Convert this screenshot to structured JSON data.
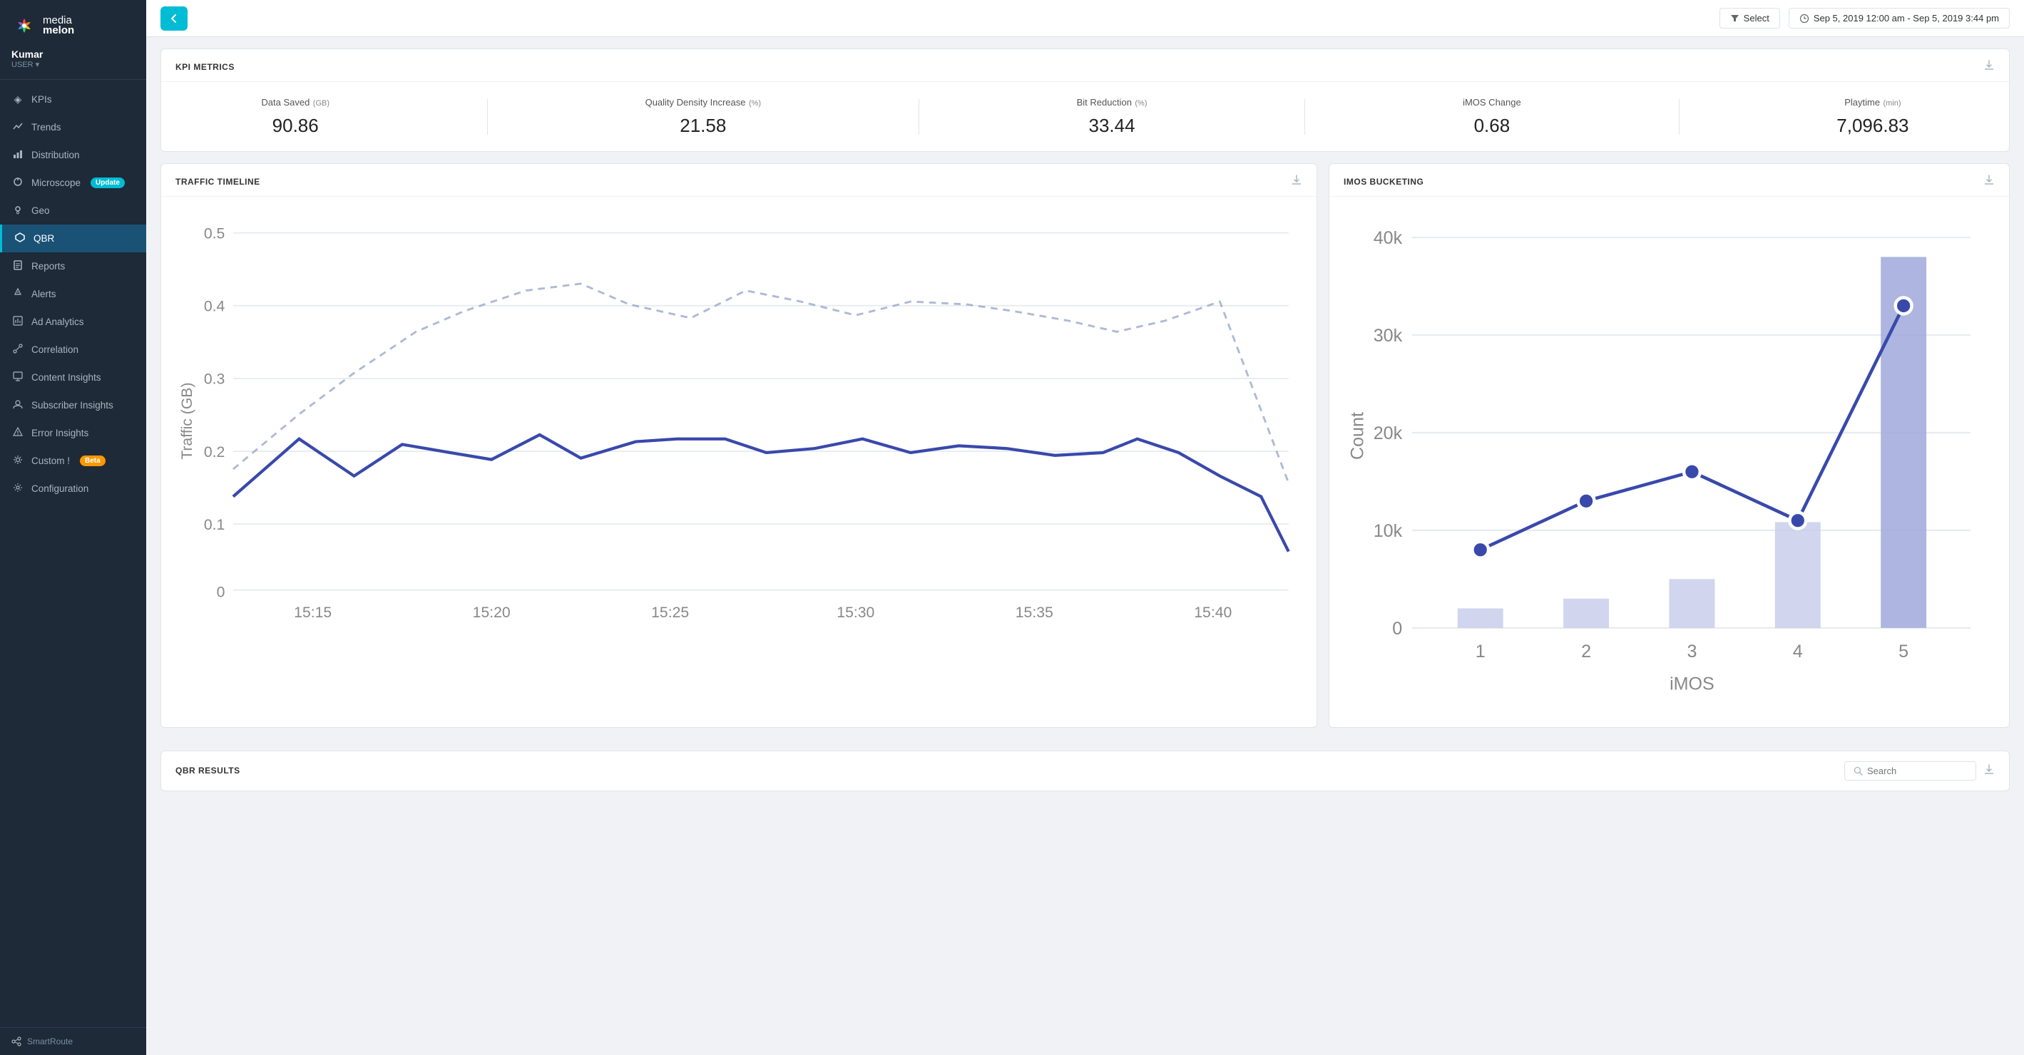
{
  "sidebar": {
    "logo_media": "media",
    "logo_melon": "melon",
    "username": "Kumar",
    "role": "USER",
    "nav_items": [
      {
        "id": "kpis",
        "label": "KPIs",
        "icon": "◈",
        "active": false
      },
      {
        "id": "trends",
        "label": "Trends",
        "icon": "📈",
        "active": false
      },
      {
        "id": "distribution",
        "label": "Distribution",
        "icon": "📊",
        "active": false
      },
      {
        "id": "microscope",
        "label": "Microscope",
        "icon": "🔬",
        "active": false,
        "badge": "Update",
        "badge_class": "badge-teal"
      },
      {
        "id": "geo",
        "label": "Geo",
        "icon": "📍",
        "active": false
      },
      {
        "id": "qbr",
        "label": "QBR",
        "icon": "⬡",
        "active": true
      },
      {
        "id": "reports",
        "label": "Reports",
        "icon": "🔔",
        "active": false
      },
      {
        "id": "alerts",
        "label": "Alerts",
        "icon": "🔔",
        "active": false
      },
      {
        "id": "ad-analytics",
        "label": "Ad Analytics",
        "icon": "📋",
        "active": false
      },
      {
        "id": "correlation",
        "label": "Correlation",
        "icon": "🔗",
        "active": false
      },
      {
        "id": "content-insights",
        "label": "Content Insights",
        "icon": "📺",
        "active": false
      },
      {
        "id": "subscriber-insights",
        "label": "Subscriber Insights",
        "icon": "👥",
        "active": false
      },
      {
        "id": "error-insights",
        "label": "Error Insights",
        "icon": "⚠",
        "active": false
      },
      {
        "id": "custom",
        "label": "Custom !",
        "icon": "⚙",
        "active": false,
        "badge": "Beta",
        "badge_class": "badge-orange"
      },
      {
        "id": "configuration",
        "label": "Configuration",
        "icon": "⚙",
        "active": false
      }
    ],
    "bottom_label": "SmartRoute"
  },
  "topbar": {
    "back_icon": "◀",
    "select_label": "Select",
    "filter_icon": "▼",
    "datetime": "Sep 5, 2019 12:00 am - Sep 5, 2019 3:44 pm",
    "clock_icon": "🕐"
  },
  "kpi_metrics": {
    "title": "KPI METRICS",
    "metrics": [
      {
        "label": "Data Saved",
        "unit": "(GB)",
        "value": "90.86"
      },
      {
        "label": "Quality Density Increase",
        "unit": "(%)",
        "value": "21.58"
      },
      {
        "label": "Bit Reduction",
        "unit": "(%)",
        "value": "33.44"
      },
      {
        "label": "iMOS Change",
        "unit": "",
        "value": "0.68"
      },
      {
        "label": "Playtime",
        "unit": "(min)",
        "value": "7,096.83"
      }
    ]
  },
  "traffic_timeline": {
    "title": "TRAFFIC TIMELINE",
    "y_label": "Traffic (GB)",
    "y_values": [
      "0.5",
      "0.4",
      "0.3",
      "0.2",
      "0.1",
      "0"
    ],
    "x_values": [
      "15:15",
      "15:20",
      "15:25",
      "15:30",
      "15:35",
      "15:40"
    ]
  },
  "imos_bucketing": {
    "title": "iMOS BUCKETING",
    "y_label": "Count",
    "y_values": [
      "40k",
      "30k",
      "20k",
      "10k",
      "0"
    ],
    "x_values": [
      "1",
      "2",
      "3",
      "4",
      "5"
    ],
    "x_label": "iMOS"
  },
  "qbr_results": {
    "title": "QBR RESULTS",
    "search_placeholder": "Search"
  }
}
